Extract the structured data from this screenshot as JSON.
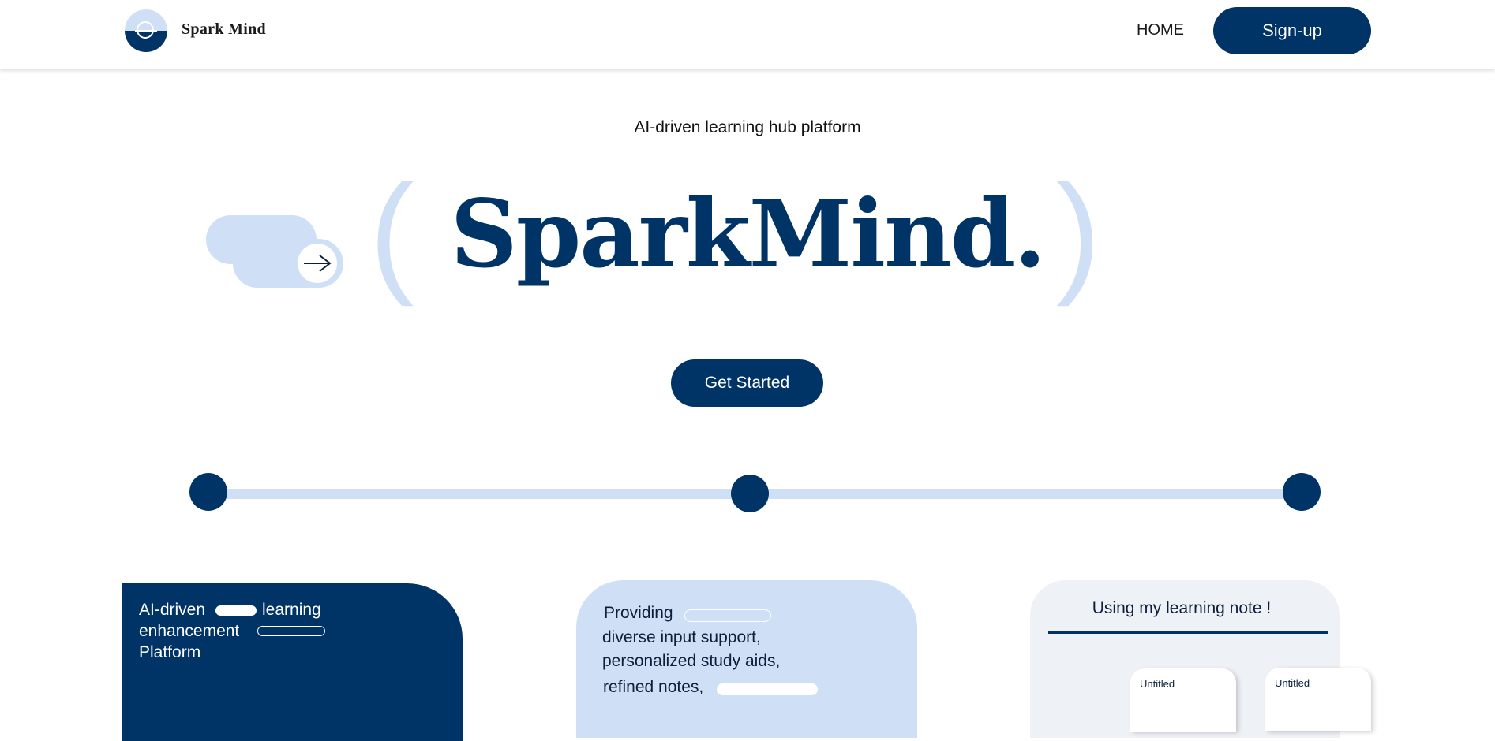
{
  "nav": {
    "brand": "Spark Mind",
    "home_label": "HOME",
    "signup_label": "Sign-up"
  },
  "hero": {
    "tagline": "AI-driven learning hub platform",
    "title": "SparkMind.",
    "paren_left": "(",
    "paren_right": ")",
    "cta_label": "Get Started"
  },
  "colors": {
    "primary": "#003366",
    "accent_light": "#cfe0f6",
    "card_gray": "#eef1f6"
  },
  "cards": {
    "card1": {
      "line1_a": "AI-driven",
      "line1_b": "learning",
      "line2": "enhancement",
      "line3": "Platform"
    },
    "card2": {
      "line1": "Providing",
      "line2": "diverse input support,",
      "line3": "personalized study aids,",
      "line4": "refined notes,"
    },
    "card3": {
      "title": "Using my learning note !",
      "notes": [
        "Untitled",
        "Untitled"
      ]
    }
  }
}
